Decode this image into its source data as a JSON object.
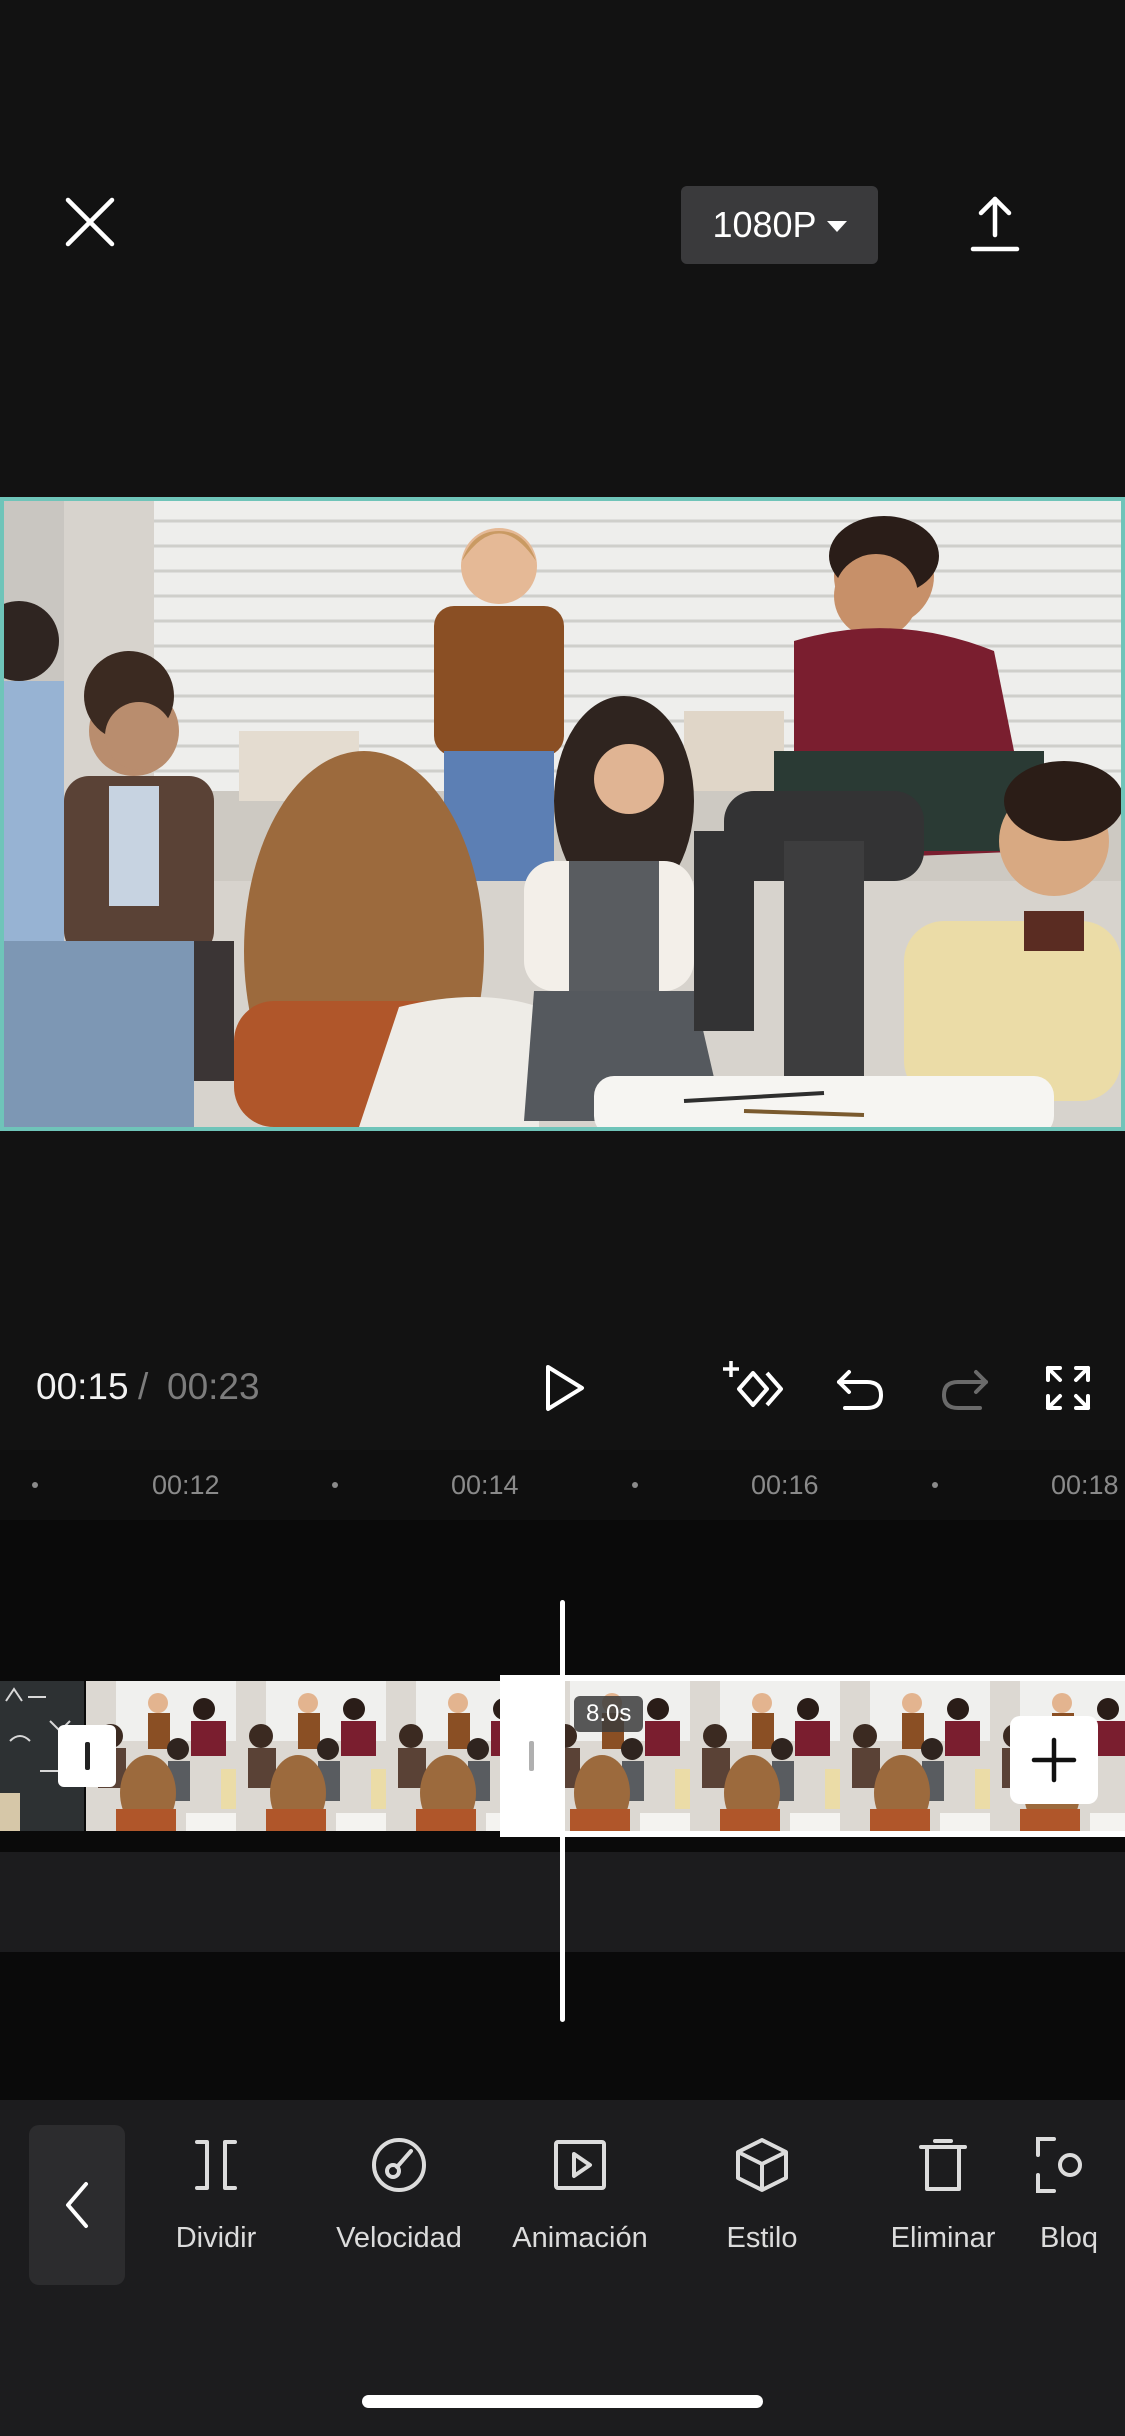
{
  "header": {
    "close_icon": "close-icon",
    "resolution": "1080P",
    "export_icon": "export-upload-icon"
  },
  "preview": {
    "selected_border_color": "#6fc4b9"
  },
  "playback": {
    "current_time": "00:15",
    "separator": "/",
    "total_time": "00:23",
    "controls": [
      "play-icon",
      "keyframe-icon",
      "undo-icon",
      "redo-icon",
      "fullscreen-icon"
    ]
  },
  "ruler": {
    "labels": [
      "00:12",
      "00:14",
      "00:16",
      "00:18"
    ]
  },
  "timeline": {
    "selected_clip_duration": "8.0s",
    "add_clip_icon": "plus-icon"
  },
  "toolbar": {
    "back_icon": "chevron-left-icon",
    "tools": [
      {
        "label": "Dividir",
        "icon": "split-icon"
      },
      {
        "label": "Velocidad",
        "icon": "speed-icon"
      },
      {
        "label": "Animación",
        "icon": "animation-icon"
      },
      {
        "label": "Estilo",
        "icon": "style-cube-icon"
      },
      {
        "label": "Eliminar",
        "icon": "delete-icon"
      },
      {
        "label": "Bloq",
        "icon": "lock-frame-icon"
      }
    ]
  }
}
